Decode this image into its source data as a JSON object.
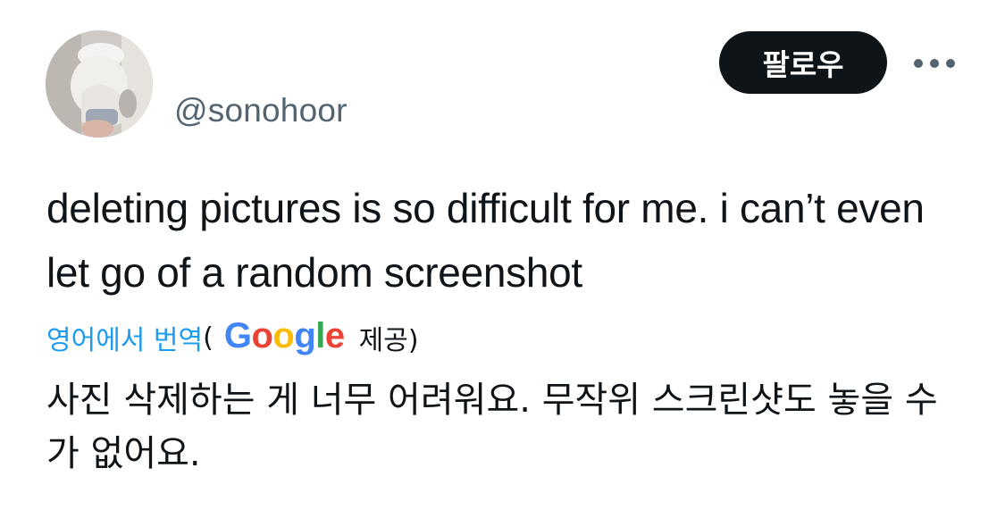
{
  "user": {
    "handle": "@sonohoor",
    "avatar_icon": "profile-photo"
  },
  "actions": {
    "follow_label": "팔로우",
    "more_icon": "more-horizontal-icon"
  },
  "tweet": {
    "text": "deleting pictures is so difficult for me. i can’t even let go of a random screenshot"
  },
  "translation": {
    "link_label": "영어에서 번역",
    "open_paren": "(",
    "provider_letters": [
      "G",
      "o",
      "o",
      "g",
      "l",
      "e"
    ],
    "provided_label": "제공)",
    "translated_text": "사진 삭제하는 게 너무 어려워요. 무작위 스크린샷도 놓을 수가 없어요."
  },
  "colors": {
    "text_primary": "#0f1419",
    "text_secondary": "#536471",
    "link": "#1d9bf0",
    "follow_bg": "#0f1419",
    "google_blue": "#4285f4",
    "google_red": "#ea4335",
    "google_yellow": "#fbbc05",
    "google_green": "#34a853"
  }
}
